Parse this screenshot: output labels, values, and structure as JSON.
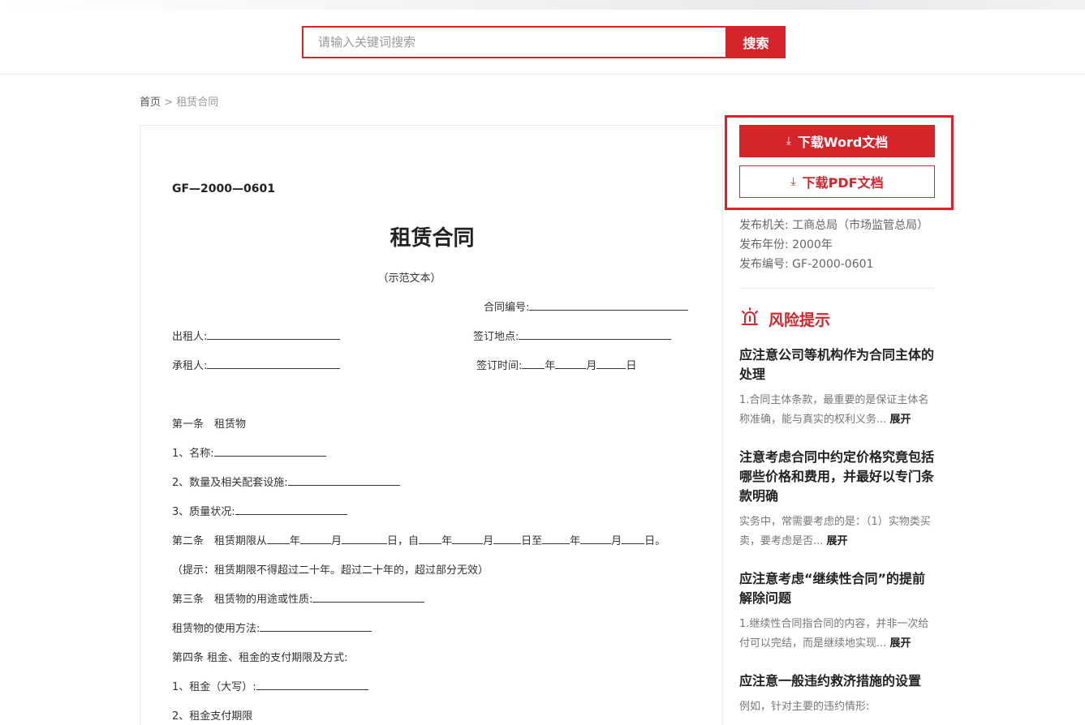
{
  "search": {
    "placeholder": "请输入关键词搜索",
    "button_label": "搜索"
  },
  "breadcrumb": {
    "home": "首页",
    "separator": " > ",
    "current": "租赁合同"
  },
  "document": {
    "code": "GF—2000—0601",
    "title": "租赁合同",
    "subtitle": "（示范文本）",
    "contract_no_label": "合同编号:",
    "lessor_label": "出租人:",
    "sign_place_label": "签订地点:",
    "lessee_label": "承租人:",
    "sign_time_label": "签订时间:",
    "year": "年",
    "month": "月",
    "day": "日",
    "art1": "第一条　租赁物",
    "item1": "1、名称:",
    "item2": "2、数量及相关配套设施:",
    "item3": "3、质量状况:",
    "art2_prefix": "第二条　租赁期限从",
    "art2_from": "日，自",
    "art2_to": "日至",
    "art2_end": "日。",
    "hint": "（提示：租赁期限不得超过二十年。超过二十年的，超过部分无效）",
    "art3": "第三条　租赁物的用途或性质:",
    "usage": "租赁物的使用方法:",
    "art4": "第四条  租金、租金的支付期限及方式:",
    "rent1": "1、租金（大写）:",
    "rent2": "2、租金支付期限"
  },
  "sidebar": {
    "download_word": "下载Word文档",
    "download_pdf": "下载PDF文档",
    "meta": [
      {
        "label": "发布机关:",
        "value": "工商总局（市场监管总局）"
      },
      {
        "label": "发布年份:",
        "value": "2000年"
      },
      {
        "label": "发布编号:",
        "value": "GF-2000-0601"
      }
    ],
    "risk_title": "风险提示",
    "expand_label": "展开",
    "risks": [
      {
        "q": "应注意公司等机构作为合同主体的处理",
        "a": "1.合同主体条款，最重要的是保证主体名称准确，能与真实的权利义务..."
      },
      {
        "q": "注意考虑合同中约定价格究竟包括哪些价格和费用，并最好以专门条款明确",
        "a": "实务中，常需要考虑的是：（1）实物类买卖，要考虑是否..."
      },
      {
        "q": "应注意考虑“继续性合同”的提前解除问题",
        "a": "1.继续性合同指合同的内容，并非一次给付可以完结，而是继续地实现..."
      },
      {
        "q": "应注意一般违约救济措施的设置",
        "a": "例如，针对主要的违约情形:"
      }
    ]
  }
}
